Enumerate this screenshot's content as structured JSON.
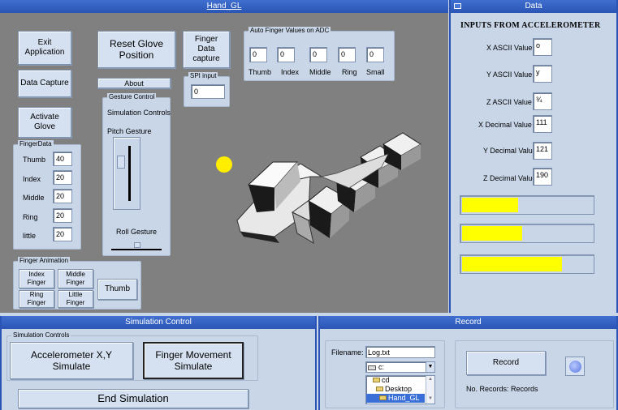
{
  "main_window": {
    "title": "Hand_GL"
  },
  "buttons": {
    "exit": "Exit Application",
    "reset": "Reset Glove Position",
    "finger_capture": "Finger Data capture",
    "data_capture": "Data Capture",
    "about": "About",
    "activate": "Activate Glove"
  },
  "auto_finger": {
    "legend": "Auto Finger Values on ADC",
    "fields": [
      {
        "label": "Thumb",
        "value": "0"
      },
      {
        "label": "Index",
        "value": "0"
      },
      {
        "label": "Middle",
        "value": "0"
      },
      {
        "label": "Ring",
        "value": "0"
      },
      {
        "label": "Small",
        "value": "0"
      }
    ]
  },
  "spi": {
    "legend": "SPI input",
    "value": "0"
  },
  "gesture": {
    "legend": "Gesture Control",
    "sim_label": "Simulation Controls",
    "pitch_label": "Pitch Gesture",
    "roll_label": "Roll Gesture"
  },
  "finger_data": {
    "legend": "FingerData",
    "fields": [
      {
        "label": "Thumb",
        "value": "40"
      },
      {
        "label": "Index",
        "value": "20"
      },
      {
        "label": "Middle",
        "value": "20"
      },
      {
        "label": "Ring",
        "value": "20"
      },
      {
        "label": "little",
        "value": "20"
      }
    ]
  },
  "finger_anim": {
    "legend": "Finger Animation",
    "index": "Index Finger",
    "middle": "Middle Finger",
    "ring": "Ring Finger",
    "little": "Little Finger",
    "thumb": "Thumb"
  },
  "data_window": {
    "title": "Data",
    "heading": "INPUTS FROM ACCELEROMETER",
    "rows": [
      {
        "label": "X ASCII Value",
        "value": "o"
      },
      {
        "label": "Y ASCII Value",
        "value": "y"
      },
      {
        "label": "Z ASCII Value",
        "value": "¾"
      },
      {
        "label": "X Decimal Value",
        "value": "111"
      },
      {
        "label": "Y Decimal Value",
        "value": "121"
      },
      {
        "label": "Z Decimal Value",
        "value": "190"
      }
    ],
    "bar_levels": [
      0.43,
      0.46,
      0.77
    ]
  },
  "sim_window": {
    "title": "Simulation Control",
    "legend": "Simulation Controls",
    "accel": "Accelerometer X,Y Simulate",
    "finger": "Finger Movement Simulate",
    "end": "End Simulation"
  },
  "record_window": {
    "title": "Record",
    "filename_label": "Filename:",
    "filename": "Log.txt",
    "drive": "c:",
    "folders": [
      "cd",
      "Desktop",
      "Hand_GL"
    ],
    "record_button": "Record",
    "records_label": "No. Records:",
    "records_value": "Records"
  },
  "colors": {
    "titlebar": "#2b55b5",
    "viewport": "#808080",
    "panel": "#c8d6e8",
    "bar_fill": "#ffff00",
    "ball": "#ffee00"
  }
}
